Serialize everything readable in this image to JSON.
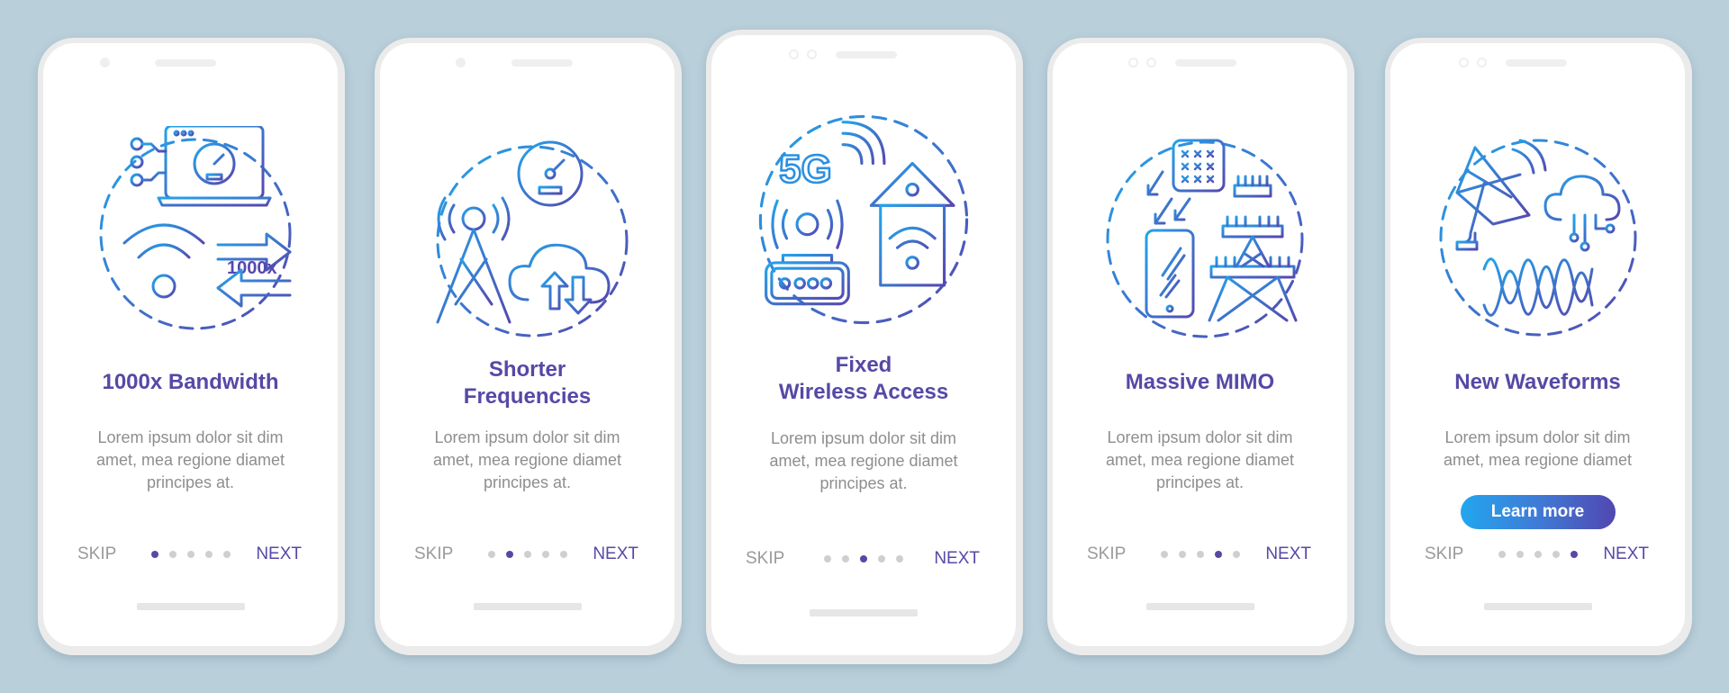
{
  "colors": {
    "background": "#b9cfda",
    "title": "#5549a6",
    "body_text": "#8e8e8e",
    "skip": "#9a9a9a",
    "next": "#5549a6",
    "dot_active": "#5549a6",
    "dot_inactive": "#cfcfcf",
    "icon_gradient_start": "#23a4ea",
    "icon_gradient_end": "#5548b0"
  },
  "screens": [
    {
      "title": "1000x Bandwidth",
      "title_lines": [
        "1000x Bandwidth"
      ],
      "body": "Lorem ipsum dolor sit dim amet, mea regione diamet principes at.",
      "body_lines": [
        "Lorem ipsum dolor sit dim",
        "amet, mea regione diamet",
        "principes at."
      ],
      "illustration": "bandwidth-illustration",
      "illustration_label": "1000x",
      "skip_label": "SKIP",
      "next_label": "NEXT",
      "active_page": 1,
      "page_count": 5
    },
    {
      "title": "Shorter Frequencies",
      "title_lines": [
        "Shorter",
        "Frequencies"
      ],
      "body": "Lorem ipsum dolor sit dim amet, mea regione diamet principes at.",
      "body_lines": [
        "Lorem ipsum dolor sit dim",
        "amet, mea regione diamet",
        "principes at."
      ],
      "illustration": "frequencies-illustration",
      "skip_label": "SKIP",
      "next_label": "NEXT",
      "active_page": 2,
      "page_count": 5
    },
    {
      "title": "Fixed Wireless Access",
      "title_lines": [
        "Fixed",
        "Wireless Access"
      ],
      "body": "Lorem ipsum dolor sit dim amet, mea regione diamet principes at.",
      "body_lines": [
        "Lorem ipsum dolor sit dim",
        "amet, mea regione diamet",
        "principes at."
      ],
      "illustration": "fixed-wireless-illustration",
      "illustration_label": "5G",
      "skip_label": "SKIP",
      "next_label": "NEXT",
      "active_page": 3,
      "page_count": 5
    },
    {
      "title": "Massive MIMO",
      "title_lines": [
        "Massive MIMO"
      ],
      "body": "Lorem ipsum dolor sit dim amet, mea regione diamet principes at.",
      "body_lines": [
        "Lorem ipsum dolor sit dim",
        "amet, mea regione diamet",
        "principes at."
      ],
      "illustration": "massive-mimo-illustration",
      "skip_label": "SKIP",
      "next_label": "NEXT",
      "active_page": 4,
      "page_count": 5
    },
    {
      "title": "New Waveforms",
      "title_lines": [
        "New Waveforms"
      ],
      "body": "Lorem ipsum dolor sit dim amet, mea regione diamet",
      "body_lines": [
        "Lorem ipsum dolor sit dim",
        "amet, mea regione diamet"
      ],
      "illustration": "waveforms-illustration",
      "button_label": "Learn more",
      "skip_label": "SKIP",
      "next_label": "NEXT",
      "active_page": 5,
      "page_count": 5
    }
  ]
}
